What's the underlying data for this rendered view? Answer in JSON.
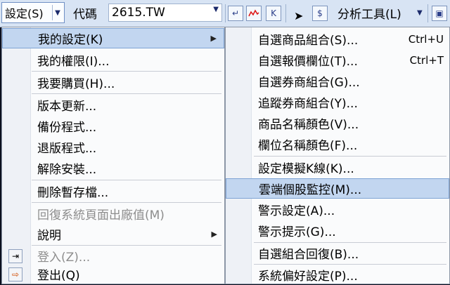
{
  "toolbar": {
    "settings_label": "設定(S)",
    "code_label": "代碼",
    "code_value": "2615.TW",
    "analysis_label": "分析工具(L)",
    "icons": [
      "enter-icon",
      "chart-line-icon",
      "k-line-icon",
      "cursor-icon",
      "dollar-icon"
    ],
    "k_glyph": "K",
    "dollar_glyph": "$"
  },
  "settings_menu": {
    "items": [
      {
        "label": "我的設定(K)",
        "submenu": true,
        "highlighted": true
      },
      {
        "label": "我的權限(I)..."
      },
      {
        "label": "我要購買(H)..."
      },
      {
        "label": "版本更新..."
      },
      {
        "label": "備份程式..."
      },
      {
        "label": "退版程式..."
      },
      {
        "label": "解除安裝..."
      },
      {
        "label": "刪除暫存檔..."
      },
      {
        "label": "回復系統頁面出廠值(M)",
        "disabled": true
      },
      {
        "label": "說明",
        "submenu": true
      },
      {
        "label": "登入(Z)...",
        "disabled": true,
        "icon": "login-icon"
      },
      {
        "label": "登出(Q)",
        "icon": "logout-icon"
      }
    ]
  },
  "my_settings_submenu": {
    "items": [
      {
        "label": "自選商品組合(S)...",
        "shortcut": "Ctrl+U"
      },
      {
        "label": "自選報價欄位(T)...",
        "shortcut": "Ctrl+T"
      },
      {
        "label": "自選券商組合(G)..."
      },
      {
        "label": "追蹤券商組合(Y)..."
      },
      {
        "label": "商品名稱顏色(V)..."
      },
      {
        "label": "欄位名稱顏色(F)..."
      },
      {
        "label": "設定模擬K線(K)..."
      },
      {
        "label": "雲端個股監控(M)...",
        "highlighted": true
      },
      {
        "label": "警示設定(A)..."
      },
      {
        "label": "警示提示(G)..."
      },
      {
        "label": "自選組合回復(B)..."
      },
      {
        "label": "系統偏好設定(P)..."
      }
    ]
  },
  "colors": {
    "highlight": "#c2d6f0",
    "highlight_border": "#7ea3d4",
    "toolbar_bg": "#d8e4f4",
    "disabled_text": "#8d8d8d"
  }
}
